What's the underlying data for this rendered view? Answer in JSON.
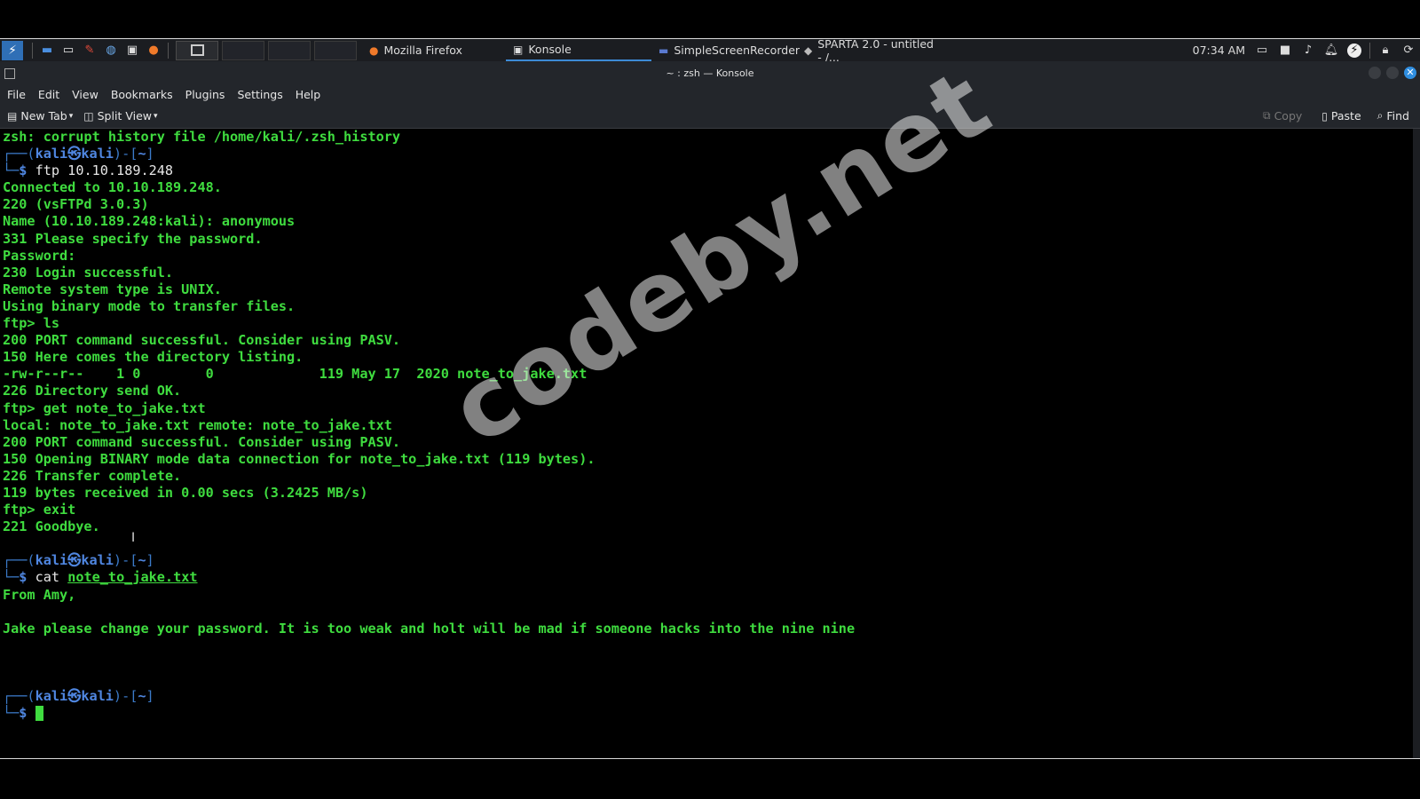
{
  "taskbar": {
    "tasks": [
      {
        "label": "Mozilla Firefox",
        "icon": "firefox-icon"
      },
      {
        "label": "Konsole",
        "icon": "konsole-icon",
        "active": true
      },
      {
        "label": "SimpleScreenRecorder",
        "icon": "recorder-icon"
      },
      {
        "label": "SPARTA 2.0 - untitled - /...",
        "icon": "sparta-icon"
      }
    ],
    "clock": "07:34 AM"
  },
  "window": {
    "title": "~ : zsh — Konsole"
  },
  "menubar": [
    "File",
    "Edit",
    "View",
    "Bookmarks",
    "Plugins",
    "Settings",
    "Help"
  ],
  "toolbar": {
    "new_tab": "New Tab",
    "split_view": "Split View",
    "copy": "Copy",
    "paste": "Paste",
    "find": "Find"
  },
  "terminal": {
    "prompt": {
      "frame_top": "┌──(",
      "user": "kali㉿kali",
      "frame_mid": ")-[",
      "dir": "~",
      "frame_end": "]",
      "frame_bottom": "└─",
      "symbol": "$"
    },
    "lines_before": [
      "zsh: corrupt history file /home/kali/.zsh_history"
    ],
    "cmd1": "ftp 10.10.189.248",
    "output1": [
      "Connected to 10.10.189.248.",
      "220 (vsFTPd 3.0.3)",
      "Name (10.10.189.248:kali): anonymous",
      "331 Please specify the password.",
      "Password:",
      "230 Login successful.",
      "Remote system type is UNIX.",
      "Using binary mode to transfer files.",
      "ftp> ls",
      "200 PORT command successful. Consider using PASV.",
      "150 Here comes the directory listing.",
      "-rw-r--r--    1 0        0             119 May 17  2020 note_to_jake.txt",
      "226 Directory send OK.",
      "ftp> get note_to_jake.txt",
      "local: note_to_jake.txt remote: note_to_jake.txt",
      "200 PORT command successful. Consider using PASV.",
      "150 Opening BINARY mode data connection for note_to_jake.txt (119 bytes).",
      "226 Transfer complete.",
      "119 bytes received in 0.00 secs (3.2425 MB/s)",
      "ftp> exit",
      "221 Goodbye."
    ],
    "cmd2_name": "cat",
    "cmd2_arg": "note_to_jake.txt",
    "output2": [
      "From Amy,",
      "",
      "Jake please change your password. It is too weak and holt will be mad if someone hacks into the nine nine"
    ]
  },
  "watermark": "codeby.net"
}
